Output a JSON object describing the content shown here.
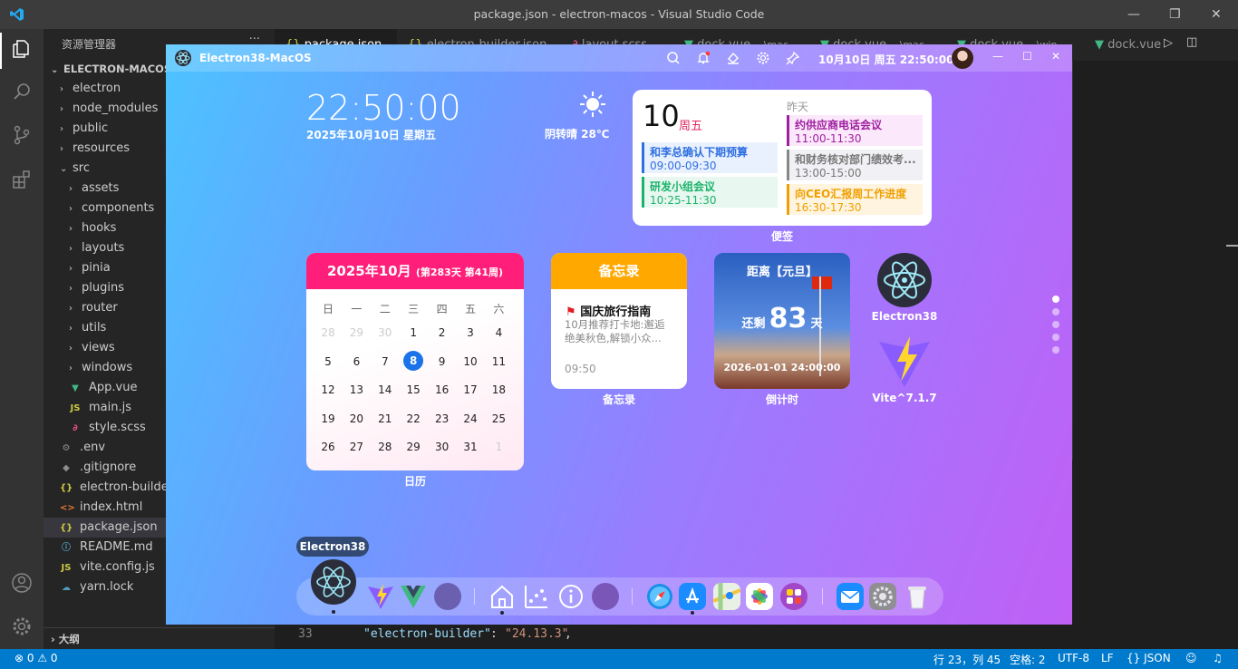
{
  "window": {
    "title": "package.json - electron-macos - Visual Studio Code"
  },
  "sidebar": {
    "title": "资源管理器",
    "root": "ELECTRON-MACOS",
    "items": [
      {
        "label": "electron",
        "type": "folder",
        "indent": 1
      },
      {
        "label": "node_modules",
        "type": "folder",
        "indent": 1
      },
      {
        "label": "public",
        "type": "folder",
        "indent": 1
      },
      {
        "label": "resources",
        "type": "folder",
        "indent": 1
      },
      {
        "label": "src",
        "type": "folder-open",
        "indent": 1
      },
      {
        "label": "assets",
        "type": "folder",
        "indent": 2
      },
      {
        "label": "components",
        "type": "folder",
        "indent": 2
      },
      {
        "label": "hooks",
        "type": "folder",
        "indent": 2
      },
      {
        "label": "layouts",
        "type": "folder",
        "indent": 2
      },
      {
        "label": "pinia",
        "type": "folder",
        "indent": 2
      },
      {
        "label": "plugins",
        "type": "folder",
        "indent": 2
      },
      {
        "label": "router",
        "type": "folder",
        "indent": 2
      },
      {
        "label": "utils",
        "type": "folder",
        "indent": 2
      },
      {
        "label": "views",
        "type": "folder",
        "indent": 2
      },
      {
        "label": "windows",
        "type": "folder",
        "indent": 2
      },
      {
        "label": "App.vue",
        "type": "vue",
        "indent": 2
      },
      {
        "label": "main.js",
        "type": "js",
        "indent": 2
      },
      {
        "label": "style.scss",
        "type": "scss",
        "indent": 2
      },
      {
        "label": ".env",
        "type": "env",
        "indent": 1
      },
      {
        "label": ".gitignore",
        "type": "git",
        "indent": 1
      },
      {
        "label": "electron-builder.js",
        "type": "json",
        "indent": 1
      },
      {
        "label": "index.html",
        "type": "html",
        "indent": 1
      },
      {
        "label": "package.json",
        "type": "json",
        "indent": 1,
        "active": true
      },
      {
        "label": "README.md",
        "type": "md",
        "indent": 1
      },
      {
        "label": "vite.config.js",
        "type": "js",
        "indent": 1
      },
      {
        "label": "yarn.lock",
        "type": "yarn",
        "indent": 1
      }
    ],
    "outline": "大纲"
  },
  "tabs": [
    {
      "label": "package.json",
      "icon": "{}",
      "active": true
    },
    {
      "label": "electron-builder.json",
      "icon": "{}"
    },
    {
      "label": "layout.scss",
      "icon": "scss"
    },
    {
      "label": "dock.vue",
      "extra": "...\\mac",
      "icon": "vue"
    },
    {
      "label": "dock.vue",
      "extra": "...\\mac",
      "icon": "vue"
    },
    {
      "label": "dock.vue",
      "extra": "...\\win",
      "icon": "vue"
    },
    {
      "label": "dock.vue",
      "icon": "vue"
    }
  ],
  "code": {
    "line_number": "33",
    "key": "\"electron-builder\"",
    "colon": ": ",
    "value": "\"24.13.3\"",
    "comma": ","
  },
  "status": {
    "errors": "0",
    "warnings": "0",
    "position": "行 23，列 45",
    "spaces": "空格: 2",
    "encoding": "UTF-8",
    "eol": "LF",
    "language": "JSON"
  },
  "app": {
    "name": "Electron38-MacOS",
    "datetime": "10月10日 周五 22:50:00",
    "clock": "22:50:00",
    "date_line": "2025年10月10日 星期五",
    "weather": "阴转晴 28℃",
    "notes": {
      "day": "10",
      "weekday": "周五",
      "yesterday": "昨天",
      "caption": "便签",
      "today_events": [
        {
          "title": "和李总确认下期预算",
          "time": "09:00-09:30",
          "color": "#2f6fe0",
          "bg": "#e9f1ff"
        },
        {
          "title": "研发小组会议",
          "time": "10:25-11:30",
          "color": "#1bb36b",
          "bg": "#e8f8f0"
        }
      ],
      "yesterday_events": [
        {
          "title": "约供应商电话会议",
          "time": "11:00-11:30",
          "color": "#a01fa0",
          "bg": "#fbe8fb"
        },
        {
          "title": "和财务核对部门绩效考...",
          "time": "13:00-15:00",
          "color": "#888888",
          "bg": "#f1f1f5"
        },
        {
          "title": "向CEO汇报周工作进度",
          "time": "16:30-17:30",
          "color": "#f0a000",
          "bg": "#fff4e0"
        }
      ]
    },
    "calendar": {
      "title": "2025年10月",
      "sub": "(第283天 第41周)",
      "caption": "日历",
      "weekdays": [
        "日",
        "一",
        "二",
        "三",
        "四",
        "五",
        "六"
      ],
      "days": [
        "28",
        "29",
        "30",
        "1",
        "2",
        "3",
        "4",
        "5",
        "6",
        "7",
        "8",
        "9",
        "10",
        "11",
        "12",
        "13",
        "14",
        "15",
        "16",
        "17",
        "18",
        "19",
        "20",
        "21",
        "22",
        "23",
        "24",
        "25",
        "26",
        "27",
        "28",
        "29",
        "30",
        "31",
        "1"
      ],
      "muted": [
        0,
        1,
        2,
        34
      ],
      "today_index": 10
    },
    "memo": {
      "head": "备忘录",
      "title": "国庆旅行指南",
      "body": "10月推荐打卡地:邂逅绝美秋色,解锁小众...",
      "time": "09:50",
      "caption": "备忘录"
    },
    "countdown": {
      "head": "距离【元旦】",
      "prefix": "还剩",
      "days": "83",
      "suffix": "天",
      "date": "2026-01-01 24:00:00",
      "caption": "倒计时"
    },
    "apps": [
      {
        "label": "Electron38"
      },
      {
        "label": "Vite^7.1.7"
      }
    ],
    "tooltip": "Electron38"
  }
}
